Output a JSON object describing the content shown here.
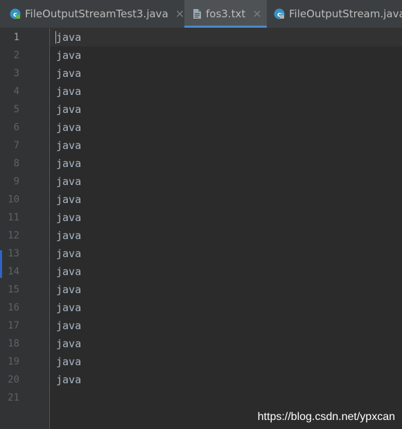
{
  "tabs": [
    {
      "label": "FileOutputStreamTest3.java",
      "icon": "java-class-icon",
      "active": false,
      "close": "×"
    },
    {
      "label": "fos3.txt",
      "icon": "text-file-icon",
      "active": true,
      "close": "×"
    },
    {
      "label": "FileOutputStream.java",
      "icon": "java-class-locked-icon",
      "active": false
    }
  ],
  "editor": {
    "lines": [
      "java",
      "java",
      "java",
      "java",
      "java",
      "java",
      "java",
      "java",
      "java",
      "java",
      "java",
      "java",
      "java",
      "java",
      "java",
      "java",
      "java",
      "java",
      "java",
      "java",
      ""
    ],
    "line_numbers": [
      "1",
      "2",
      "3",
      "4",
      "5",
      "6",
      "7",
      "8",
      "9",
      "10",
      "11",
      "12",
      "13",
      "14",
      "15",
      "16",
      "17",
      "18",
      "19",
      "20",
      "21"
    ],
    "current_line": 1
  },
  "watermark": "https://blog.csdn.net/ypxcan",
  "colors": {
    "background": "#2b2b2b",
    "tab_bar": "#3c3f41",
    "active_tab_underline": "#4a88c7",
    "code_text": "#a9b7c6",
    "line_number": "#606366"
  }
}
